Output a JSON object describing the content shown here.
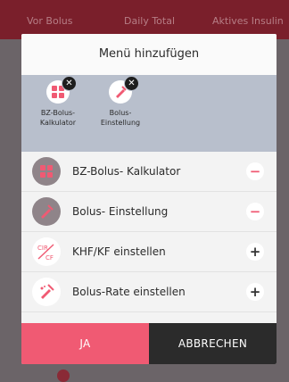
{
  "background": {
    "tabs": [
      "Vor Bolus",
      "Daily Total",
      "Aktives Insulin"
    ]
  },
  "dialog": {
    "title": "Menü hinzufügen",
    "selected": [
      {
        "label": "BZ-Bolus-\nKalkulator",
        "icon": "calculator-icon",
        "remove_glyph": "✕"
      },
      {
        "label": "Bolus-\nEinstellung",
        "icon": "bolus-settings-icon",
        "remove_glyph": "✕"
      }
    ],
    "items": [
      {
        "label": "BZ-Bolus- Kalkulator",
        "icon": "calculator-icon",
        "action": "remove",
        "action_glyph": "−"
      },
      {
        "label": "Bolus- Einstellung",
        "icon": "bolus-settings-icon",
        "action": "remove",
        "action_glyph": "−"
      },
      {
        "label": "KHF/KF einstellen",
        "icon": "cir-cf-icon",
        "icon_text_top": "CIR",
        "icon_text_bottom": "CF",
        "action": "add",
        "action_glyph": "+"
      },
      {
        "label": "Bolus-Rate einstellen",
        "icon": "bolus-rate-icon",
        "action": "add",
        "action_glyph": "+"
      }
    ],
    "buttons": {
      "ok": "JA",
      "cancel": "ABBRECHEN"
    }
  },
  "colors": {
    "accent": "#f05a73",
    "header": "#7a1f2b",
    "selected_bg": "#b8bfcc",
    "dark_button": "#2b2b2b"
  }
}
